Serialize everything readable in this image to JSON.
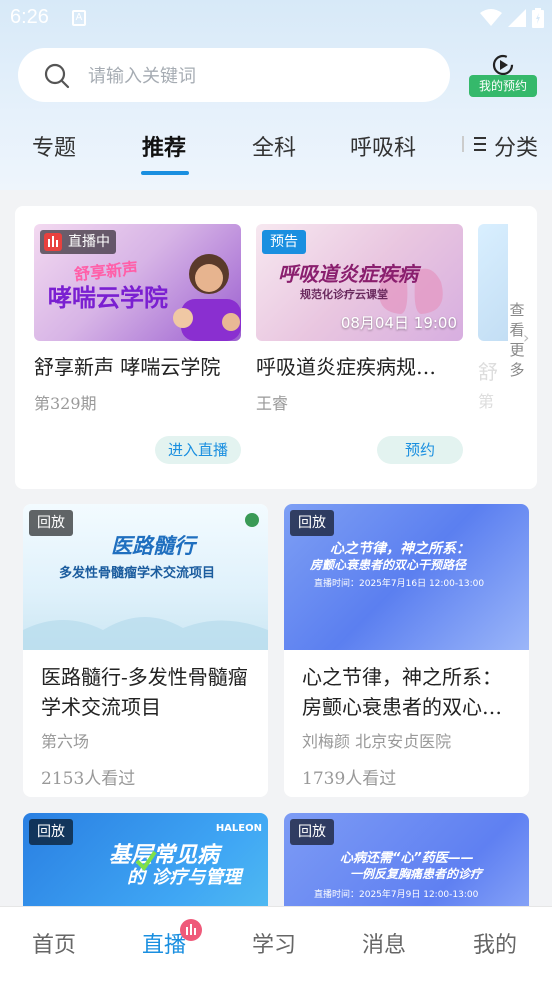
{
  "status_bar": {
    "time": "6:26",
    "notif_icon": "A"
  },
  "search": {
    "placeholder": "请输入关键词"
  },
  "booking": {
    "label": "我的预约"
  },
  "tabs": [
    {
      "label": "专题"
    },
    {
      "label": "推荐"
    },
    {
      "label": "全科"
    },
    {
      "label": "呼吸科"
    },
    {
      "label": "分类"
    }
  ],
  "live_section": {
    "cards": [
      {
        "badge": "直播中",
        "thumb_text_line1": "舒享新声",
        "thumb_text_line2": "哮喘云学院",
        "title": "舒享新声  哮喘云学院",
        "subtitle": "第329期",
        "action": "进入直播"
      },
      {
        "badge": "预告",
        "thumb_text_line1": "呼吸道炎症疾病",
        "thumb_text_line2": "规范化诊疗云课堂",
        "datetime": "08月04日  19:00",
        "title": "呼吸道炎症疾病规…",
        "subtitle": "王睿",
        "action": "预约"
      }
    ],
    "peek_title": "舒",
    "peek_sub": "第",
    "more": "查看更多"
  },
  "replays": [
    {
      "badge": "回放",
      "thumb_line1": "医路髓行",
      "thumb_line2": "多发性骨髓瘤学术交流项目",
      "title": "医路髓行-多发性骨髓瘤学术交流项目",
      "subtitle": "第六场",
      "views": "2153人看过"
    },
    {
      "badge": "回放",
      "thumb_line1": "心之节律，神之所系：",
      "thumb_line2": "房颤心衰患者的双心干预路径",
      "thumb_line3": "直播时间：2025年7月16日 12:00-13:00",
      "title": "心之节律，神之所系：房颤心衰患者的双心…",
      "subtitle": "刘梅颜  北京安贞医院",
      "views": "1739人看过"
    },
    {
      "badge": "回放",
      "thumb_line1": "基层常见病",
      "thumb_line2": "的 诊疗与管理",
      "brand": "HALEON"
    },
    {
      "badge": "回放",
      "thumb_line1": "心病还需“心”药医——",
      "thumb_line2": "一例反复胸痛患者的诊疗",
      "thumb_line3": "直播时间：2025年7月9日 12:00-13:00"
    }
  ],
  "bottom_nav": [
    {
      "label": "首页"
    },
    {
      "label": "直播"
    },
    {
      "label": "学习"
    },
    {
      "label": "消息"
    },
    {
      "label": "我的"
    }
  ],
  "colors": {
    "accent": "#1a8fe0",
    "live_red": "#e8413e",
    "green": "#35b96b"
  }
}
